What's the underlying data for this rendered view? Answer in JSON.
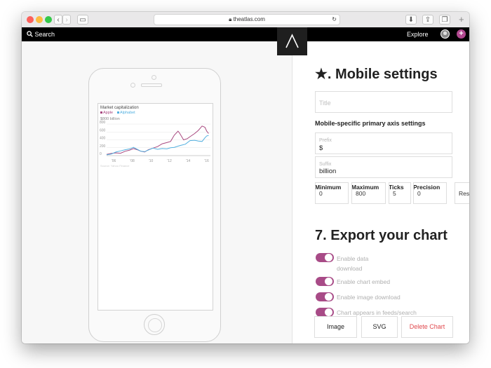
{
  "browser": {
    "url": "theatlas.com"
  },
  "nav": {
    "search_label": "Search",
    "explore_label": "Explore"
  },
  "preview_chart": {
    "title": "Market capitalization",
    "unit_label": "$800 billion",
    "source_text": "Source: Yahoo Finance"
  },
  "chart_data": {
    "type": "line",
    "title": "Market capitalization",
    "ylabel": "$800 billion",
    "ylim": [
      0,
      800
    ],
    "yticks": [
      "800",
      "600",
      "400",
      "200",
      "0"
    ],
    "xticks": [
      "'06",
      "'08",
      "'10",
      "'12",
      "'14",
      "'16"
    ],
    "series": [
      {
        "name": "Apple",
        "color": "#a8487f",
        "points": [
          [
            2005,
            30
          ],
          [
            2005.5,
            55
          ],
          [
            2006,
            70
          ],
          [
            2006.5,
            60
          ],
          [
            2007,
            110
          ],
          [
            2007.5,
            140
          ],
          [
            2007.9,
            180
          ],
          [
            2008.3,
            150
          ],
          [
            2008.7,
            110
          ],
          [
            2009.1,
            90
          ],
          [
            2009.5,
            150
          ],
          [
            2010,
            190
          ],
          [
            2010.5,
            230
          ],
          [
            2011,
            300
          ],
          [
            2011.5,
            330
          ],
          [
            2011.9,
            360
          ],
          [
            2012.3,
            520
          ],
          [
            2012.7,
            620
          ],
          [
            2012.9,
            560
          ],
          [
            2013.3,
            400
          ],
          [
            2013.7,
            430
          ],
          [
            2014,
            480
          ],
          [
            2014.5,
            560
          ],
          [
            2014.9,
            640
          ],
          [
            2015.3,
            750
          ],
          [
            2015.6,
            720
          ],
          [
            2015.8,
            620
          ],
          [
            2016,
            560
          ]
        ]
      },
      {
        "name": "Alphabet",
        "color": "#52b0e0",
        "points": [
          [
            2005,
            20
          ],
          [
            2005.5,
            40
          ],
          [
            2006,
            90
          ],
          [
            2006.5,
            120
          ],
          [
            2007,
            150
          ],
          [
            2007.5,
            170
          ],
          [
            2007.9,
            210
          ],
          [
            2008.3,
            160
          ],
          [
            2008.7,
            110
          ],
          [
            2009.1,
            100
          ],
          [
            2009.5,
            140
          ],
          [
            2010,
            190
          ],
          [
            2010.5,
            160
          ],
          [
            2011,
            180
          ],
          [
            2011.5,
            170
          ],
          [
            2011.9,
            200
          ],
          [
            2012.3,
            210
          ],
          [
            2012.7,
            240
          ],
          [
            2013,
            260
          ],
          [
            2013.5,
            290
          ],
          [
            2014,
            380
          ],
          [
            2014.5,
            390
          ],
          [
            2014.9,
            370
          ],
          [
            2015.3,
            360
          ],
          [
            2015.6,
            450
          ],
          [
            2015.8,
            500
          ],
          [
            2016,
            510
          ]
        ]
      }
    ]
  },
  "panel": {
    "mobile_heading": "★. Mobile settings",
    "title_placeholder": "Title",
    "axis_heading": "Mobile-specific primary axis settings",
    "prefix_label": "Prefix",
    "prefix_value": "$",
    "suffix_label": "Suffix",
    "suffix_value": "billion",
    "minimum_label": "Minimum",
    "maximum_label": "Maximum",
    "ticks_label": "Ticks",
    "precision_label": "Precision",
    "minimum_value": "0",
    "maximum_value": "800",
    "ticks_value": "5",
    "precision_value": "0",
    "reset_label": "Reset",
    "export_heading": "7. Export your chart",
    "options": [
      "Enable data download",
      "Enable chart embed",
      "Enable image download",
      "Chart appears in feeds/search"
    ],
    "image_button": "Image",
    "svg_button": "SVG",
    "delete_button": "Delete Chart",
    "delete_color": "#e0484d",
    "toggle_color": "#a84b87"
  }
}
